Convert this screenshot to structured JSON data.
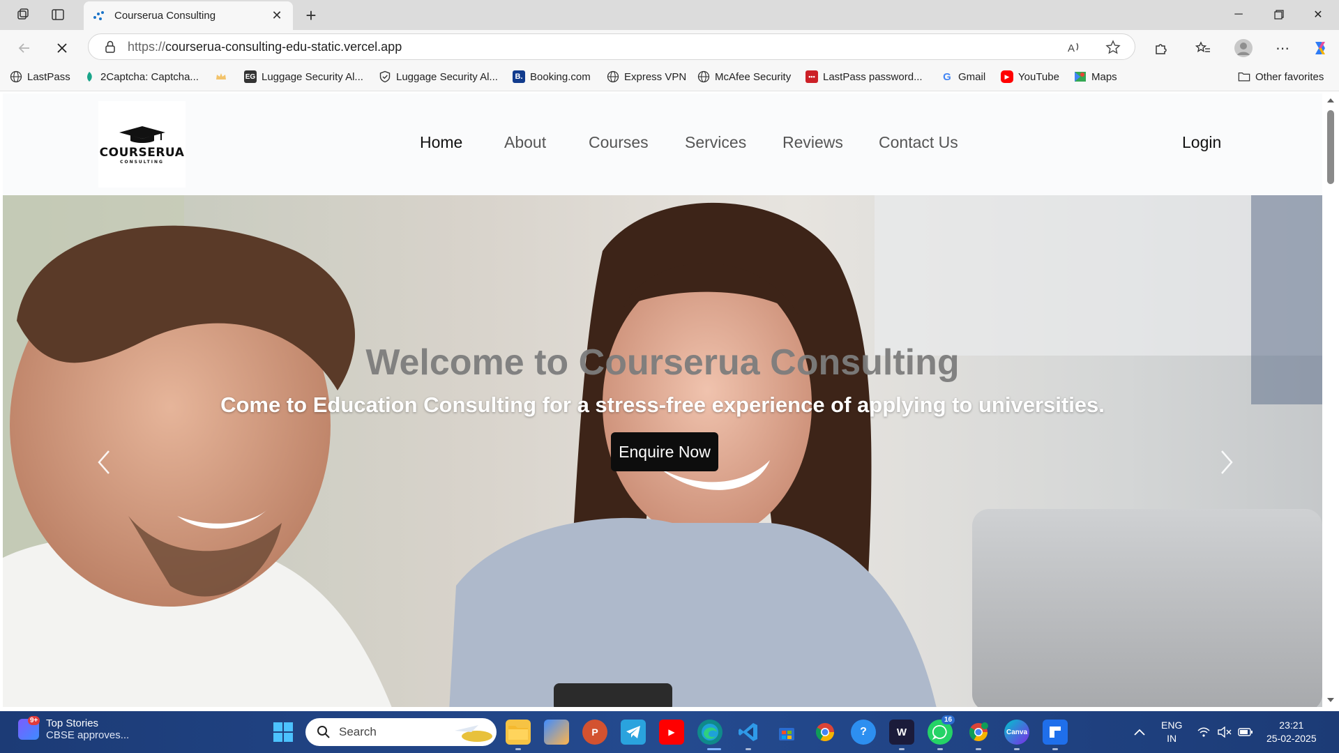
{
  "browser": {
    "tab_title": "Courserua Consulting",
    "url_protocol": "https://",
    "url_host": "courserua-consulting-edu-static.vercel.app",
    "favorites": [
      {
        "label": "LastPass",
        "icon": "globe-icon"
      },
      {
        "label": "2Captcha: Captcha...",
        "icon": "captcha-icon"
      },
      {
        "label": "",
        "icon": "crown-icon"
      },
      {
        "label": "Luggage Security Al...",
        "icon": "eg-icon"
      },
      {
        "label": "Luggage Security Al...",
        "icon": "shield-icon"
      },
      {
        "label": "Booking.com",
        "icon": "booking-icon"
      },
      {
        "label": "Express VPN",
        "icon": "globe-icon"
      },
      {
        "label": "McAfee Security",
        "icon": "globe-icon"
      },
      {
        "label": "LastPass password...",
        "icon": "lastpass-icon"
      },
      {
        "label": "Gmail",
        "icon": "google-icon"
      },
      {
        "label": "YouTube",
        "icon": "youtube-icon"
      },
      {
        "label": "Maps",
        "icon": "maps-icon"
      }
    ],
    "other_favorites": "Other favorites"
  },
  "site": {
    "logo_word": "COURSERUA",
    "logo_sub": "CONSULTING",
    "nav": [
      "Home",
      "About",
      "Courses",
      "Services",
      "Reviews",
      "Contact Us"
    ],
    "login": "Login",
    "hero": {
      "title": "Welcome to Courserua Consulting",
      "subtitle": "Come to Education Consulting for a stress-free experience of applying to universities.",
      "cta": "Enquire Now"
    }
  },
  "taskbar": {
    "widget_title": "Top Stories",
    "widget_sub": "CBSE approves...",
    "widget_badge": "9+",
    "search_placeholder": "Search",
    "whatsapp_badge": "16",
    "lang_line1": "ENG",
    "lang_line2": "IN",
    "time": "23:21",
    "date": "25-02-2025"
  },
  "colors": {
    "accent_button": "#0d0d0d",
    "taskbar": "#1f3d7a",
    "hero_title": "#7d7d7d"
  }
}
